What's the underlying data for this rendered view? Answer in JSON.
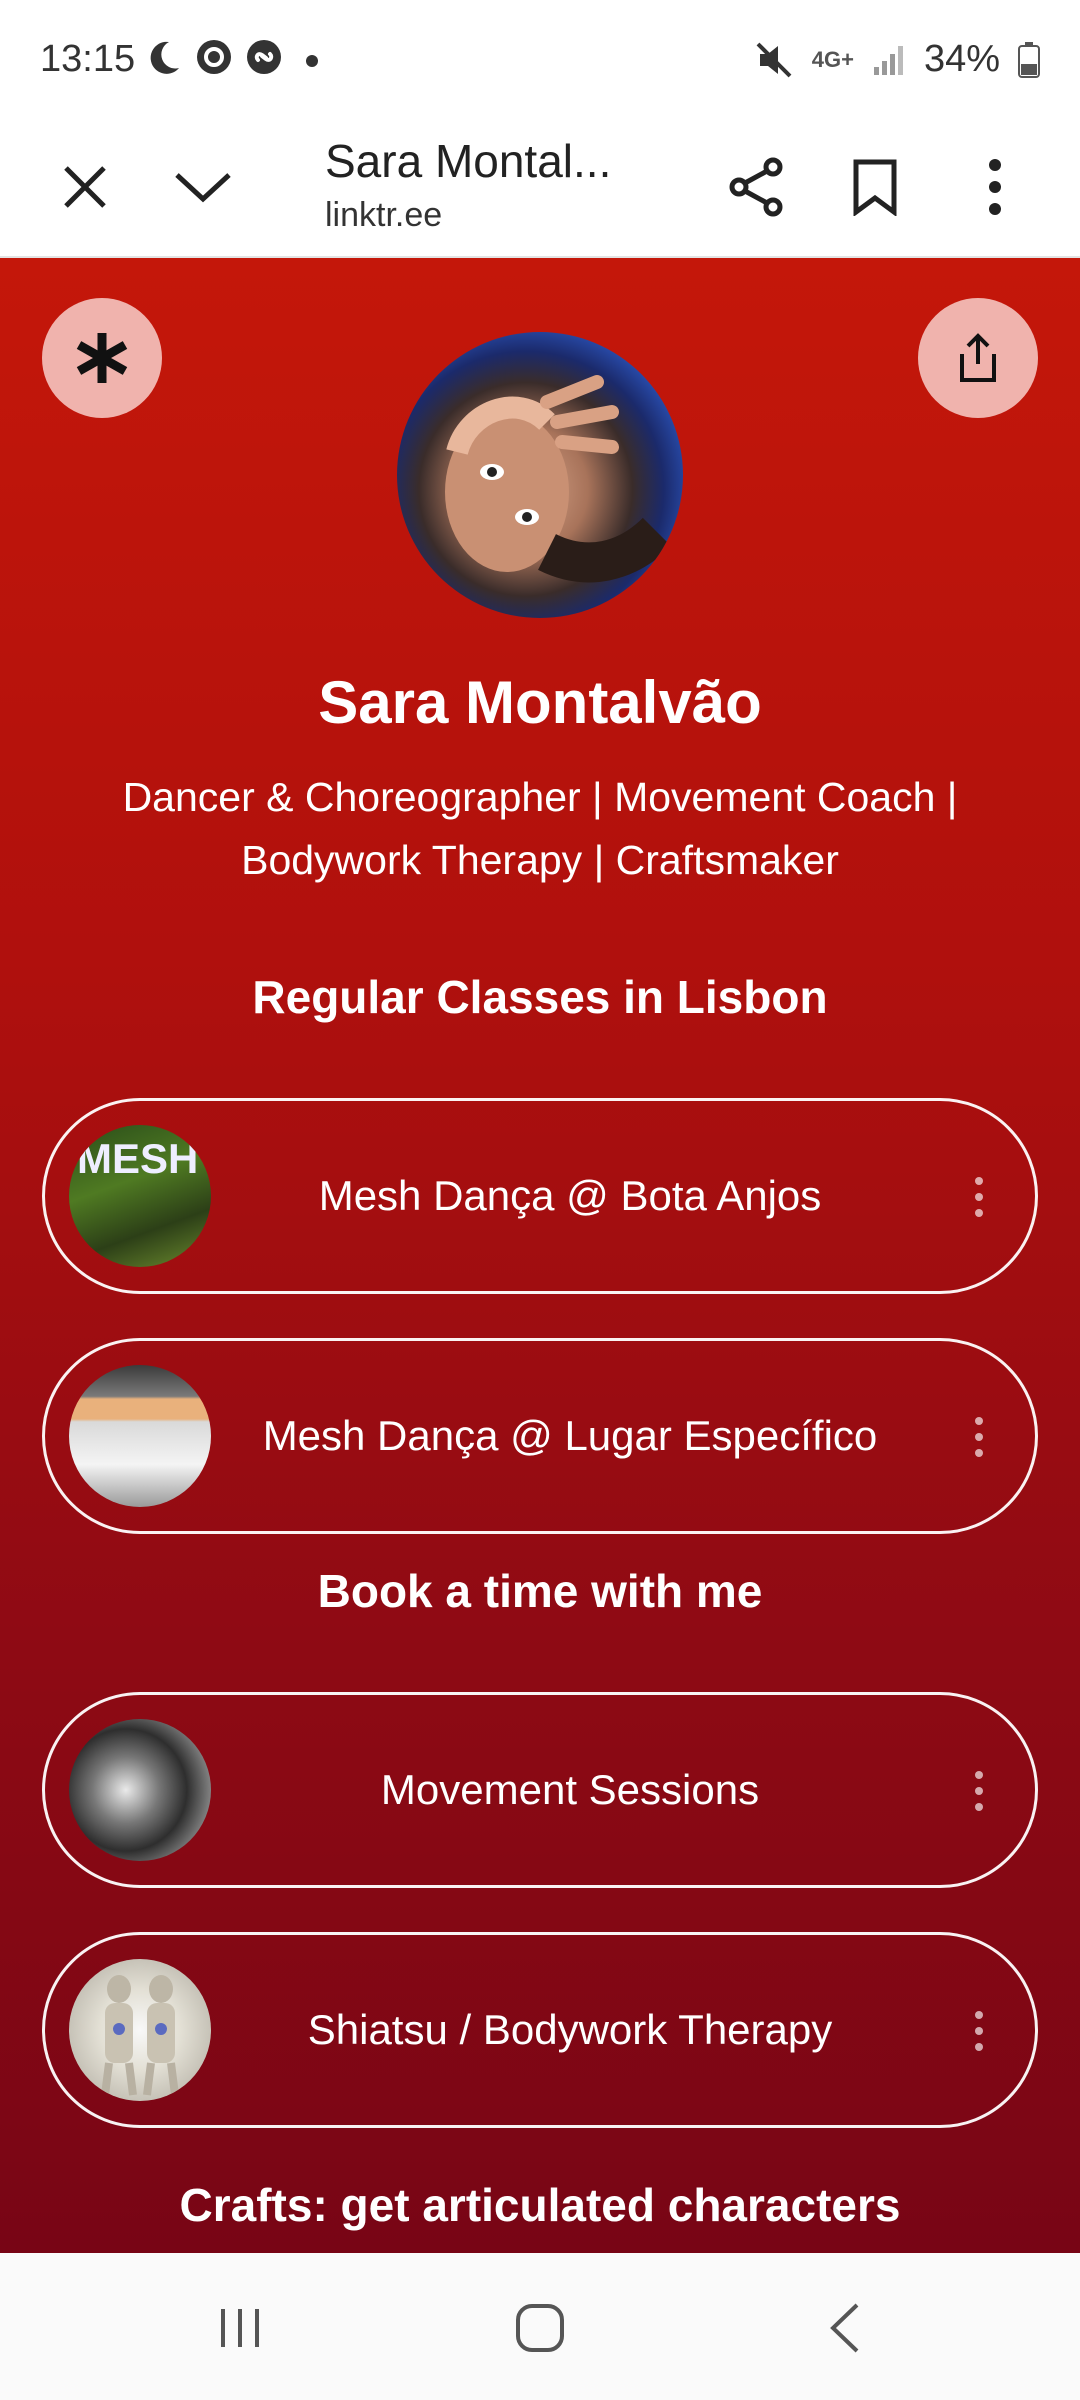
{
  "status_bar": {
    "time": "13:15",
    "network": "4G+",
    "battery": "34%"
  },
  "browser": {
    "title": "Sara Montal...",
    "url": "linktr.ee"
  },
  "profile": {
    "name": "Sara Montalvão",
    "bio": "Dancer & Choreographer | Movement Coach | Bodywork Therapy | Craftsmaker"
  },
  "sections": {
    "classes_heading": "Regular Classes in Lisbon",
    "booking_heading": "Book a time with me",
    "crafts_heading": "Crafts: get articulated characters"
  },
  "links": [
    {
      "label": "Mesh Dança @ Bota Anjos",
      "thumb_text": "MESH"
    },
    {
      "label": "Mesh Dança @ Lugar Específico"
    },
    {
      "label": "Movement Sessions"
    },
    {
      "label": "Shiatsu / Bodywork Therapy"
    }
  ],
  "colors": {
    "page_top": "#c4170a",
    "page_bottom": "#780515",
    "round_button": "#f0b3ad"
  }
}
